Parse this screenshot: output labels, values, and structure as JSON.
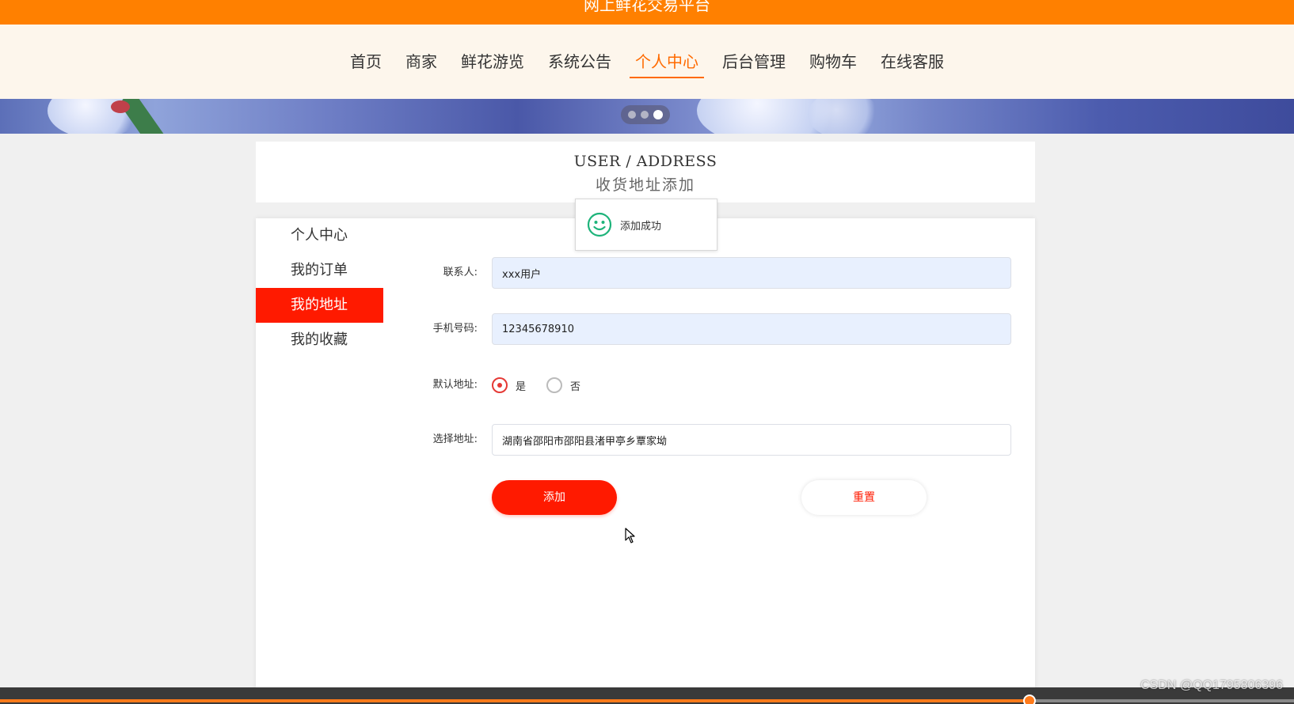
{
  "header": {
    "site_title": "网上鲜花交易平台"
  },
  "nav": {
    "items": [
      {
        "label": "首页"
      },
      {
        "label": "商家"
      },
      {
        "label": "鲜花游览"
      },
      {
        "label": "系统公告"
      },
      {
        "label": "个人中心",
        "active": true
      },
      {
        "label": "后台管理"
      },
      {
        "label": "购物车"
      },
      {
        "label": "在线客服"
      }
    ]
  },
  "banner": {
    "slides": 3,
    "active_slide": 3
  },
  "page_header": {
    "title_en": "USER / ADDRESS",
    "title_cn": "收货地址添加"
  },
  "sidebar": {
    "items": [
      {
        "label": "个人中心"
      },
      {
        "label": "我的订单"
      },
      {
        "label": "我的地址",
        "active": true
      },
      {
        "label": "我的收藏"
      }
    ]
  },
  "form": {
    "contact": {
      "label": "联系人:",
      "value": "xxx用户"
    },
    "phone": {
      "label": "手机号码:",
      "value": "12345678910"
    },
    "default_address": {
      "label": "默认地址:",
      "yes": "是",
      "no": "否",
      "selected": "是"
    },
    "address": {
      "label": "选择地址:",
      "value": "湖南省邵阳市邵阳县渚甲亭乡覃家坳"
    },
    "add_button": "添加",
    "reset_button": "重置"
  },
  "toast": {
    "message": "添加成功",
    "icon": "smile-icon"
  },
  "watermark": "CSDN @QQ1795806396",
  "colors": {
    "topbar": "#ff8000",
    "accent": "#ff1a00",
    "nav_active": "#ff6a00",
    "toast_icon": "#1db37a"
  }
}
